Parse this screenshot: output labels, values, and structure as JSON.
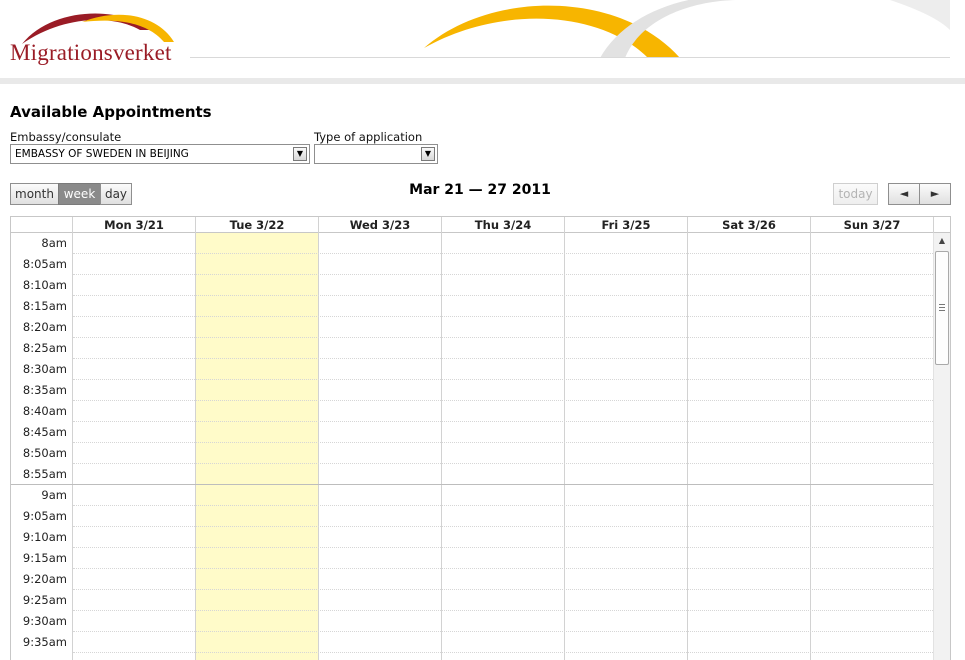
{
  "brand": {
    "logo_text": "Migrationsverket",
    "colors": {
      "red": "#9a1c26",
      "gold": "#f7b500",
      "gray": "#e9e9e9"
    }
  },
  "page": {
    "title": "Available Appointments"
  },
  "filters": {
    "embassy_label": "Embassy/consulate",
    "embassy_value": "EMBASSY OF SWEDEN IN BEIJING",
    "type_label": "Type of application",
    "type_value": ""
  },
  "toolbar": {
    "views": {
      "month": "month",
      "week": "week",
      "day": "day",
      "active": "week"
    },
    "range_title": "Mar 21 — 27 2011",
    "today_label": "today",
    "prev_icon": "◄",
    "next_icon": "►"
  },
  "calendar": {
    "days": [
      "Mon 3/21",
      "Tue 3/22",
      "Wed 3/23",
      "Thu 3/24",
      "Fri 3/25",
      "Sat 3/26",
      "Sun 3/27"
    ],
    "highlighted_day": "Tue 3/22",
    "times": [
      "8am",
      "8:05am",
      "8:10am",
      "8:15am",
      "8:20am",
      "8:25am",
      "8:30am",
      "8:35am",
      "8:40am",
      "8:45am",
      "8:50am",
      "8:55am",
      "9am",
      "9:05am",
      "9:10am",
      "9:15am",
      "9:20am",
      "9:25am",
      "9:30am",
      "9:35am"
    ]
  },
  "scrollbar": {
    "up_icon": "▲"
  }
}
